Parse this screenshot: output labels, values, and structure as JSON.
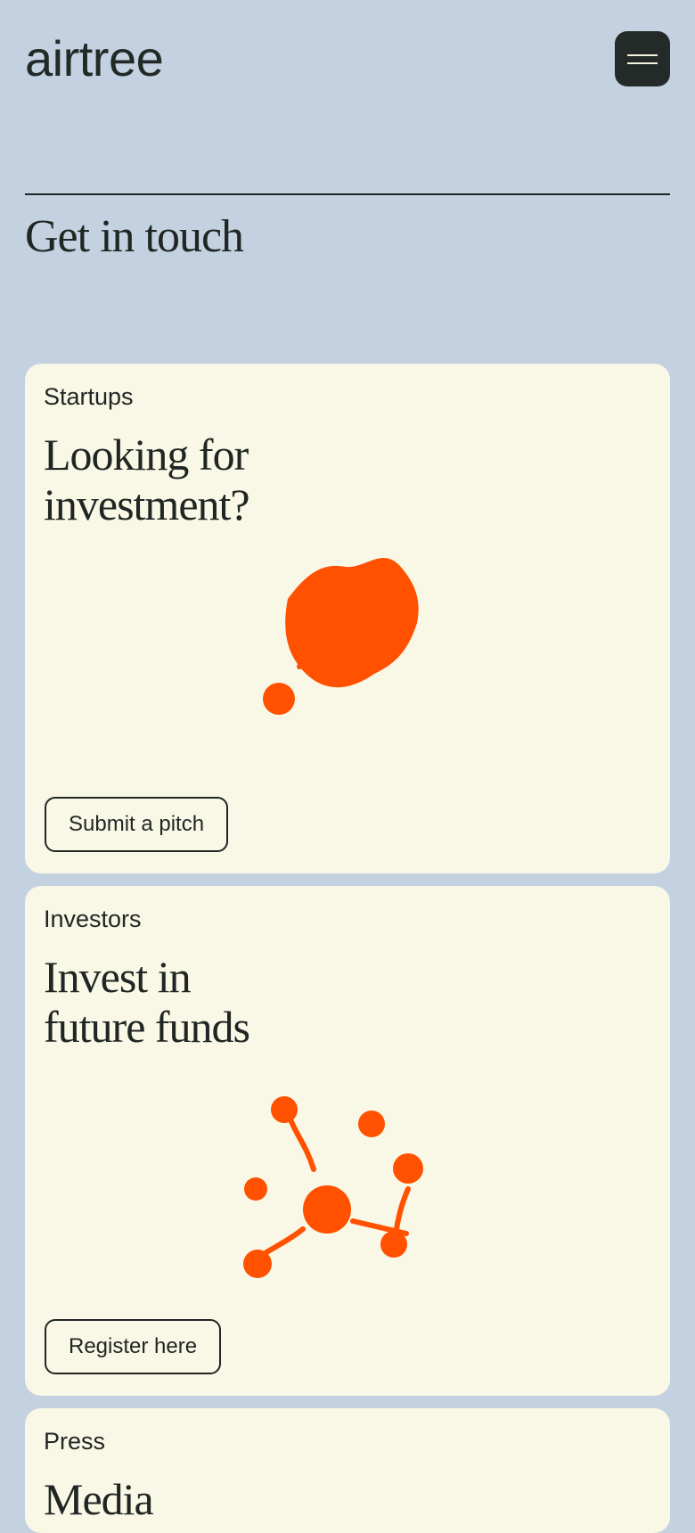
{
  "header": {
    "logo": "airtree",
    "menu_icon": "hamburger-menu-icon"
  },
  "page": {
    "title": "Get in touch"
  },
  "colors": {
    "background": "#c3d1e0",
    "card": "#f9f7e5",
    "accent": "#ff5100",
    "text": "#1f2623",
    "menu_button": "#232a27"
  },
  "cards": [
    {
      "eyebrow": "Startups",
      "headline_line1": "Looking for",
      "headline_line2": "investment?",
      "cta": "Submit a pitch",
      "illustration": "balloon-dot-illustration"
    },
    {
      "eyebrow": "Investors",
      "headline_line1": "Invest in",
      "headline_line2": "future funds",
      "cta": "Register here",
      "illustration": "network-dots-illustration"
    },
    {
      "eyebrow": "Press",
      "headline_line1": "Media"
    }
  ]
}
